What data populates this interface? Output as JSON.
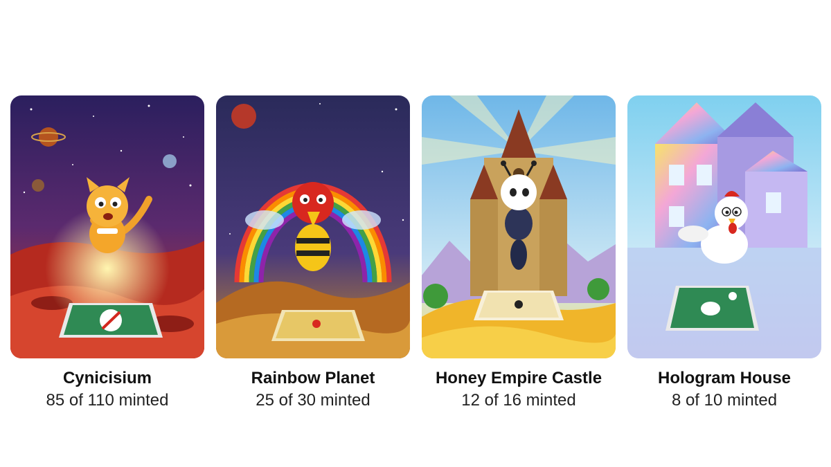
{
  "cards": [
    {
      "title": "Cynicisium",
      "minted": "85 of 110 minted",
      "minted_count": 85,
      "total_supply": 110,
      "character": "cat",
      "scene": "red-planet"
    },
    {
      "title": "Rainbow Planet",
      "minted": "25 of 30 minted",
      "minted_count": 25,
      "total_supply": 30,
      "character": "bee",
      "scene": "rainbow"
    },
    {
      "title": "Honey Empire Castle",
      "minted": "12 of 16 minted",
      "minted_count": 12,
      "total_supply": 16,
      "character": "ant",
      "scene": "castle"
    },
    {
      "title": "Hologram House",
      "minted": "8 of 10 minted",
      "minted_count": 8,
      "total_supply": 10,
      "character": "chicken",
      "scene": "house"
    }
  ]
}
